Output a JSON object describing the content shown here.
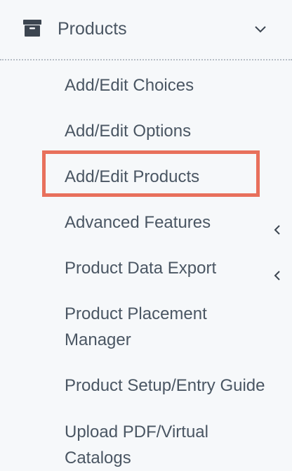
{
  "header": {
    "icon": "archive-box-icon",
    "label": "Products",
    "chevron_icon": "chevron-down-icon"
  },
  "items": [
    {
      "label": "Add/Edit Choices"
    },
    {
      "label": "Add/Edit Options"
    },
    {
      "label": "Add/Edit Products",
      "highlighted": true
    },
    {
      "label": "Advanced Features",
      "submenu_icon": "chevron-left-icon"
    },
    {
      "label": "Product Data Export",
      "submenu_icon": "chevron-left-icon"
    },
    {
      "label": "Product Placement\nManager"
    },
    {
      "label": "Product Setup/Entry Guide"
    },
    {
      "label": "Upload PDF/Virtual\nCatalogs"
    }
  ],
  "colors": {
    "background": "#f6f8fa",
    "text": "#4a5663",
    "highlight_border": "#e8705c"
  }
}
